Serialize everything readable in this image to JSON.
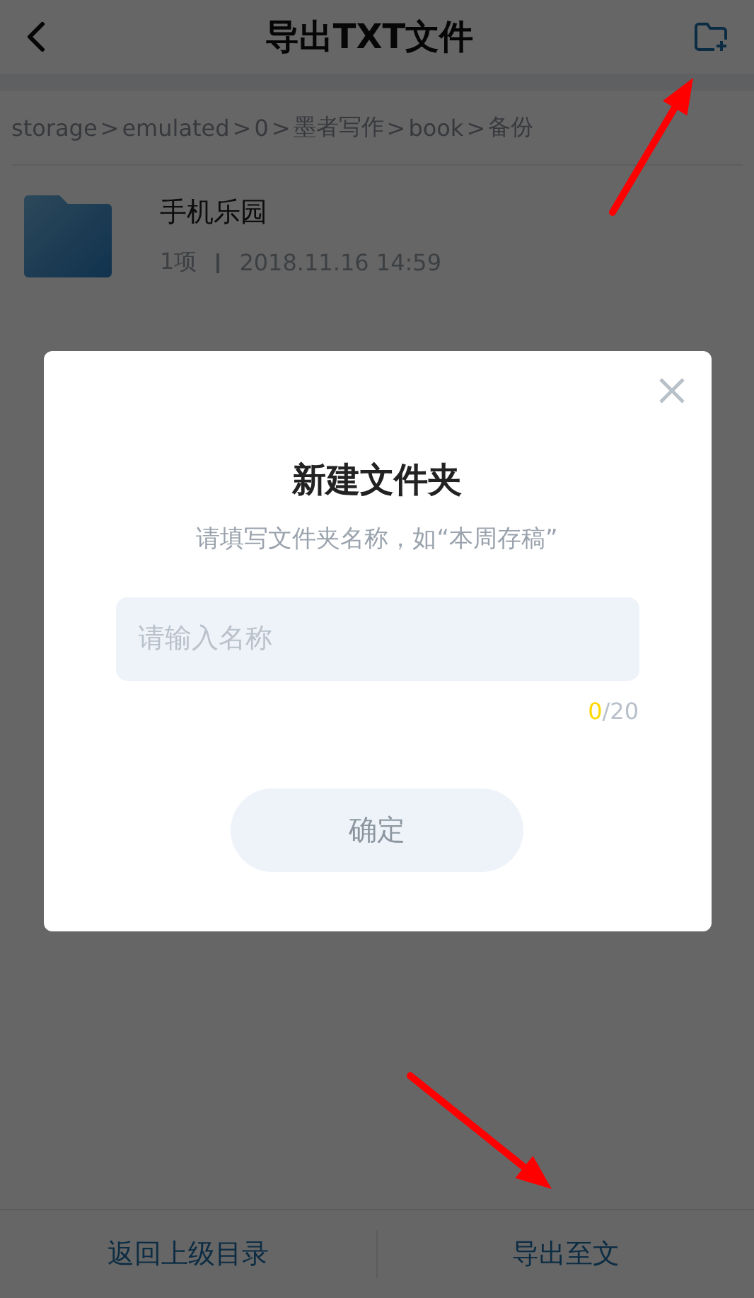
{
  "header": {
    "title": "导出TXT文件"
  },
  "breadcrumb": {
    "separator": ">",
    "path": [
      "storage",
      "emulated",
      "0",
      "墨者写作",
      "book",
      "备份"
    ]
  },
  "files": [
    {
      "name": "手机乐园",
      "count": "1项",
      "date": "2018.11.16 14:59"
    }
  ],
  "dialog": {
    "title": "新建文件夹",
    "hint": "请填写文件夹名称，如“本周存稿”",
    "placeholder": "请输入名称",
    "count": "0",
    "limit": "/20",
    "confirm": "确定"
  },
  "footer": [
    "返回上级目录",
    "导出至文"
  ]
}
